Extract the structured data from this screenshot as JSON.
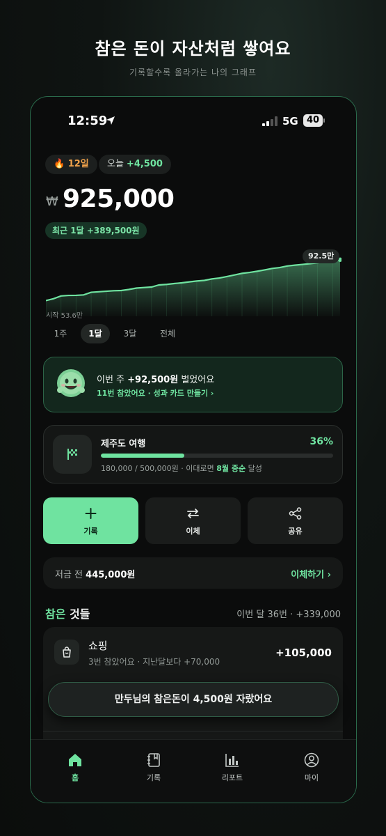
{
  "header": {
    "title": "참은 돈이 자산처럼 쌓여요",
    "subtitle": "기록할수록 올라가는 나의 그래프"
  },
  "status_bar": {
    "time": "12:59",
    "network": "5G",
    "battery": "40"
  },
  "chips": {
    "streak": "🔥 12일",
    "today_label": "오늘",
    "today_value": "+4,500",
    "month": "최근 1달 +389,500원"
  },
  "balance": {
    "currency": "₩",
    "amount": "925,000"
  },
  "chart": {
    "start_label": "시작 53.6만",
    "peak_label": "92.5만"
  },
  "chart_data": {
    "type": "area",
    "series": [
      {
        "values": [
          53.6,
          55.4,
          58.0,
          58.5,
          58.6,
          59.0,
          61.5,
          62.0,
          62.5,
          63.0,
          63.2,
          64.2,
          65.5,
          66.0,
          66.5,
          68.5,
          69.0,
          69.8,
          70.5,
          71.4,
          72.2,
          72.8,
          74.2,
          75.1,
          76.5,
          78.0,
          79.5,
          80.4,
          81.5,
          82.8,
          84.2,
          85.0,
          86.5,
          87.3,
          88.0,
          88.7,
          89.5,
          90.5,
          91.8,
          92.5
        ]
      }
    ],
    "ylim": [
      40,
      95
    ]
  },
  "ranges": [
    "1주",
    "1달",
    "3달",
    "전체"
  ],
  "range_active": 1,
  "weekly": {
    "line1_prefix": "이번 주",
    "line1_amount": "+92,500원",
    "line1_suffix": "벌었어요",
    "line2": "11번 참았어요 · 성과 카드 만들기 ›"
  },
  "goal": {
    "title": "제주도 여행",
    "percent_text": "36%",
    "progress": 0.36,
    "amounts": "180,000 / 500,000원 · 이대로면",
    "eta": "8월 중순",
    "eta_suffix": "달성"
  },
  "actions": {
    "record": "기록",
    "transfer": "이체",
    "share": "공유"
  },
  "savings": {
    "label": "저금 전",
    "amount": "445,000원",
    "link": "이체하기 ›"
  },
  "section": {
    "title_green": "참은",
    "title_rest": "것들",
    "meta": "이번 달 36번 · +339,000"
  },
  "item": {
    "name": "쇼핑",
    "sub": "3번 참았어요 · 지난달보다 +70,000",
    "value": "+105,000"
  },
  "toast": "만두님의 참은돈이 4,500원 자랐어요",
  "tabs": [
    "홈",
    "기록",
    "리포트",
    "마이"
  ],
  "colors": {
    "accent": "#6fe3a0",
    "streak": "#f0a24b",
    "background": "#0b0c0c"
  }
}
